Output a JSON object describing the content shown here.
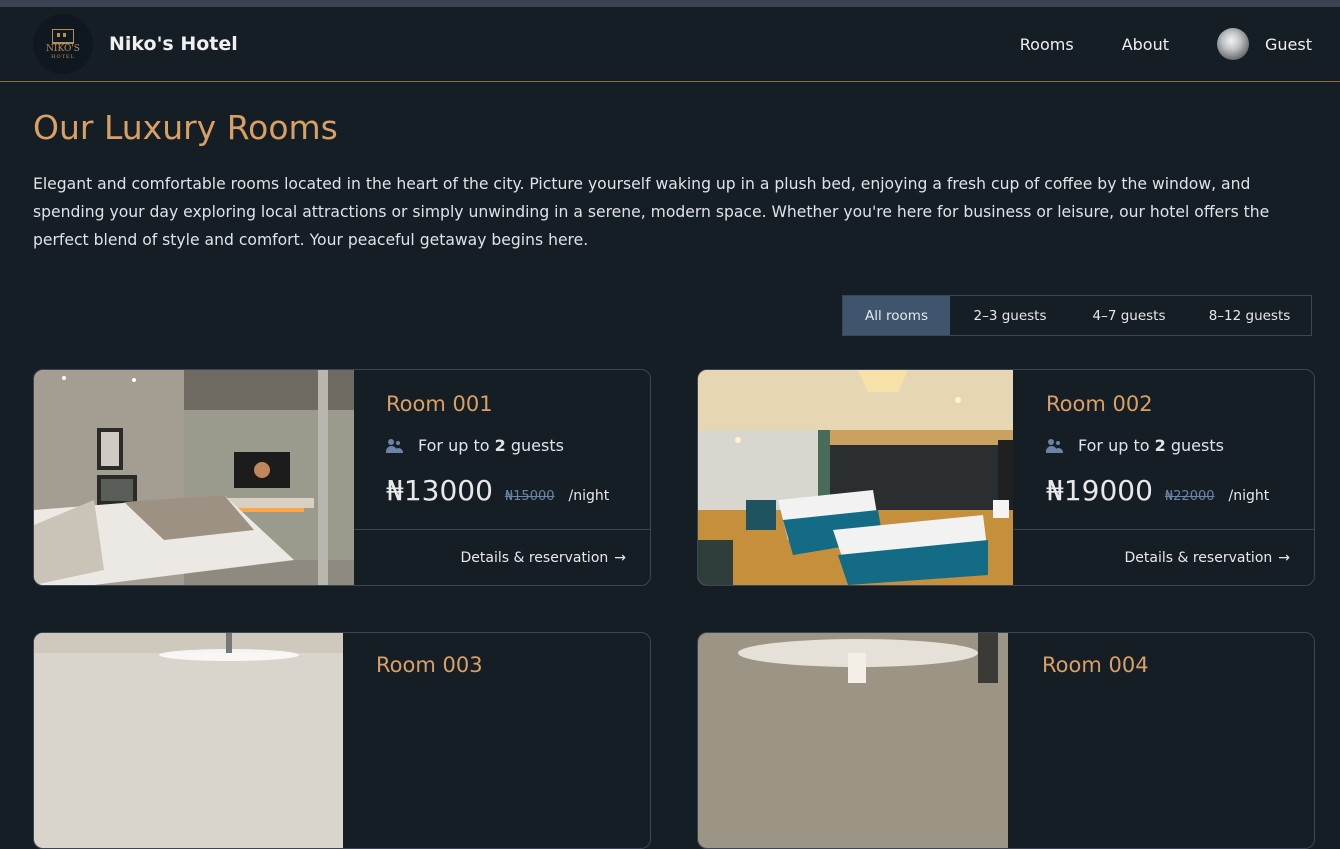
{
  "header": {
    "logo_line1": "NIKO'S",
    "logo_line2": "HOTEL",
    "brand_name": "Niko's Hotel",
    "nav": [
      {
        "label": "Rooms"
      },
      {
        "label": "About"
      }
    ],
    "user_label": "Guest"
  },
  "page": {
    "title": "Our Luxury Rooms",
    "intro": "Elegant and comfortable rooms located in the heart of the city. Picture yourself waking up in a plush bed, enjoying a fresh cup of coffee by the window, and spending your day exploring local attractions or simply unwinding in a serene, modern space. Whether you're here for business or leisure, our hotel offers the perfect blend of style and comfort. Your peaceful getaway begins here."
  },
  "filters": [
    {
      "label": "All rooms",
      "active": true
    },
    {
      "label": "2–3 guests"
    },
    {
      "label": "4–7 guests"
    },
    {
      "label": "8–12 guests"
    }
  ],
  "rooms": [
    {
      "title": "Room 001",
      "guests_prefix": "For up to",
      "guests_count": "2",
      "guests_suffix": "guests",
      "price": "₦13000",
      "old_price": "₦15000",
      "per_night": "/night",
      "link_label": "Details & reservation",
      "arrow": "→"
    },
    {
      "title": "Room 002",
      "guests_prefix": "For up to",
      "guests_count": "2",
      "guests_suffix": "guests",
      "price": "₦19000",
      "old_price": "₦22000",
      "per_night": "/night",
      "link_label": "Details & reservation",
      "arrow": "→"
    },
    {
      "title": "Room 003"
    },
    {
      "title": "Room 004"
    }
  ],
  "colors": {
    "background": "#151d25",
    "accent_gold": "#d9a066",
    "active_filter": "#3f556d",
    "muted_blue": "#6b84a6"
  },
  "icons": {
    "guests": "people-icon",
    "link_arrow": "arrow-right-icon"
  }
}
